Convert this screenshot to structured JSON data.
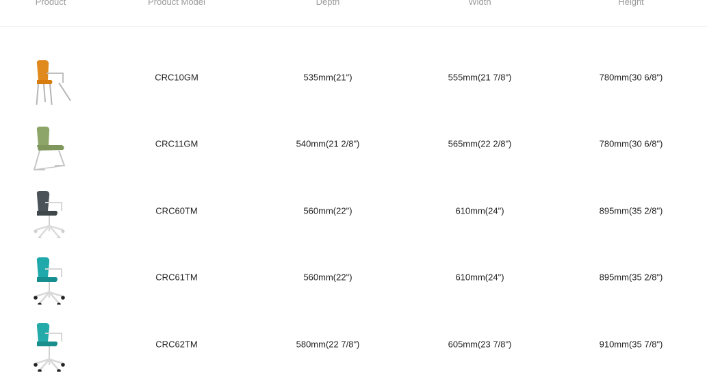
{
  "headers": {
    "product": "Product",
    "model": "Product Model",
    "depth": "Depth",
    "width": "Width",
    "height": "Height"
  },
  "rows": [
    {
      "model": "CRC10GM",
      "depth": "535mm(21\")",
      "width": "555mm(21 7/8\")",
      "height": "780mm(30 6/8\")",
      "image": "orange-chair-with-arms-4-leg",
      "color": "#e08a1e"
    },
    {
      "model": "CRC11GM",
      "depth": "540mm(21 2/8\")",
      "width": "565mm(22 2/8\")",
      "height": "780mm(30 6/8\")",
      "image": "green-chair-sled-base",
      "color": "#8ea56a"
    },
    {
      "model": "CRC60TM",
      "depth": "560mm(22\")",
      "width": "610mm(24\")",
      "height": "895mm(35 2/8\")",
      "image": "grey-swivel-chair-white-base",
      "color": "#4b5358"
    },
    {
      "model": "CRC61TM",
      "depth": "560mm(22\")",
      "width": "610mm(24\")",
      "height": "895mm(35 2/8\")",
      "image": "teal-swivel-chair-black-casters",
      "color": "#1fa9aa"
    },
    {
      "model": "CRC62TM",
      "depth": "580mm(22 7/8\")",
      "width": "605mm(23 7/8\")",
      "height": "910mm(35 7/8\")",
      "image": "teal-swivel-chair-high-base",
      "color": "#24aaa8"
    }
  ]
}
